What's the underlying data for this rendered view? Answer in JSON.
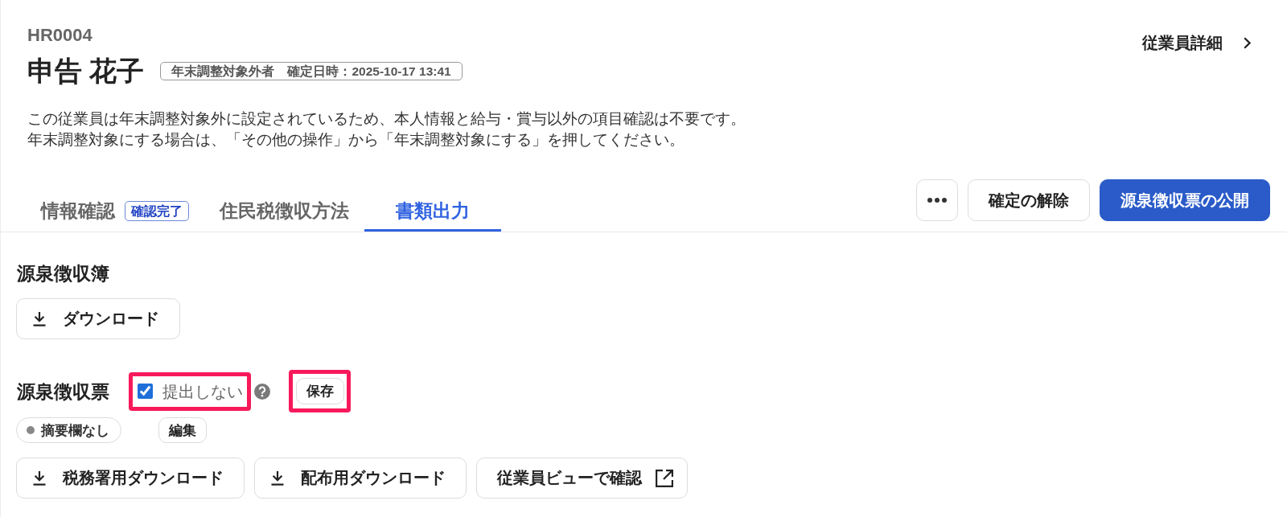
{
  "header": {
    "employee_id": "HR0004",
    "name": "申告 花子",
    "status_badge": "年末調整対象外者　確定日時：2025-10-17 13:41",
    "detail_link": "従業員詳細",
    "notice": [
      "この従業員は年末調整対象外に設定されているため、本人情報と給与・賞与以外の項目確認は不要です。",
      "年末調整対象にする場合は、「その他の操作」から「年末調整対象にする」を押してください。"
    ]
  },
  "tabs": [
    {
      "label": "情報確認",
      "badge": "確認完了",
      "selected": false
    },
    {
      "label": "住民税徴収方法",
      "selected": false
    },
    {
      "label": "書類出力",
      "selected": true
    }
  ],
  "actions": [
    {
      "kind": "more"
    },
    {
      "kind": "secondary",
      "label": "確定の解除"
    },
    {
      "kind": "primary",
      "label": "源泉徴収票の公開"
    }
  ],
  "withholding_book": {
    "title": "源泉徴収簿",
    "buttons": [
      {
        "kind": "download",
        "label": "ダウンロード"
      }
    ]
  },
  "withholding_slip": {
    "title": "源泉徴収票",
    "not_submit": {
      "label": "提出しない",
      "checked": true,
      "highlighted": true
    },
    "save": {
      "label": "保存",
      "highlighted": true
    },
    "remarks": "摘要欄なし",
    "edit": "編集",
    "buttons": [
      {
        "kind": "download",
        "label": "税務署用ダウンロード"
      },
      {
        "kind": "download",
        "label": "配布用ダウンロード"
      },
      {
        "kind": "external",
        "label": "従業員ビューで確認"
      }
    ]
  }
}
